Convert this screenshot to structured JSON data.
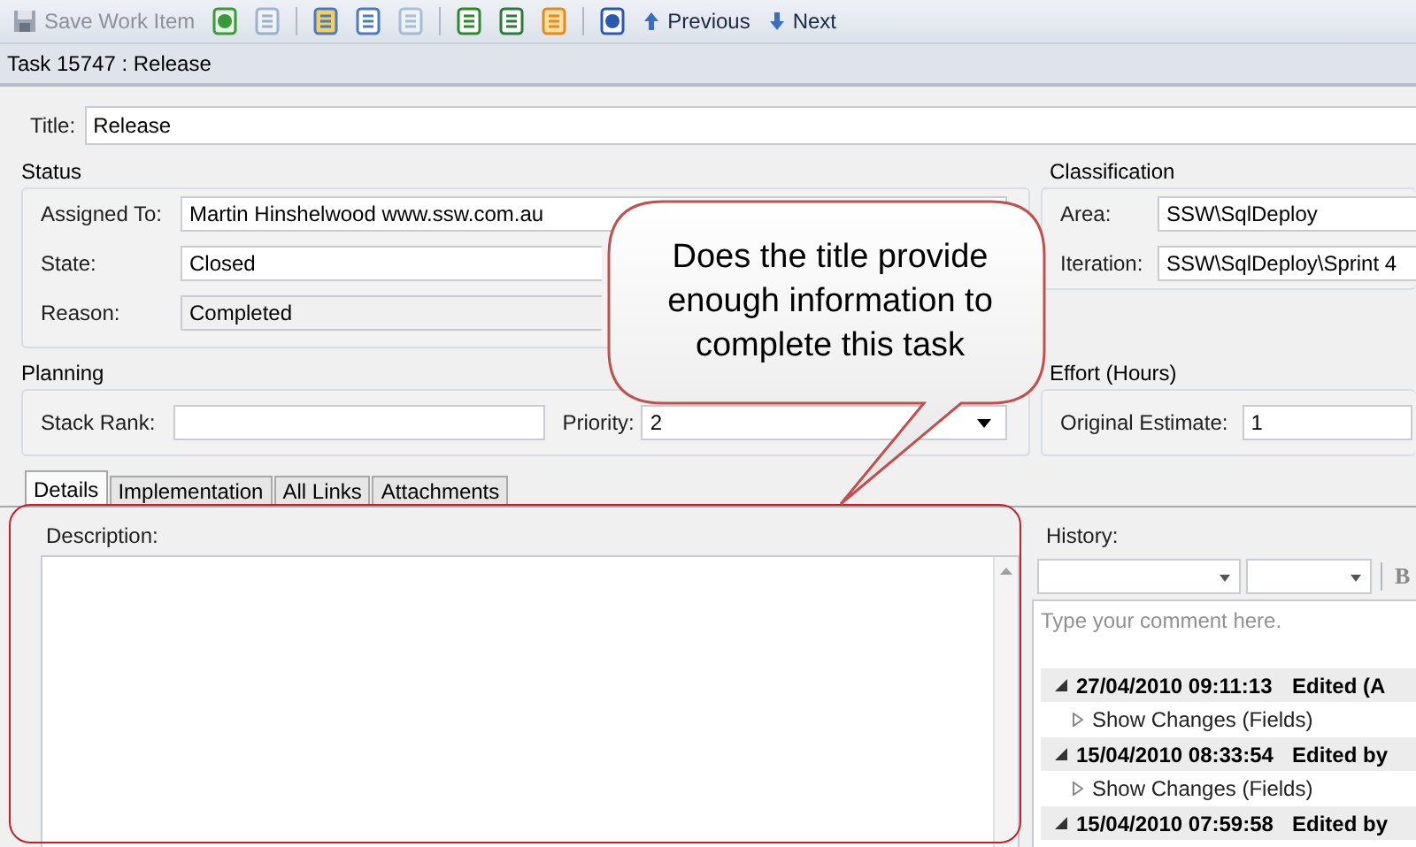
{
  "toolbar": {
    "save": {
      "label": "Save Work Item",
      "disabled": true
    },
    "icon_buttons": [
      {
        "disabled": false
      },
      {
        "disabled": true
      },
      {
        "disabled": false
      },
      {
        "disabled": false
      },
      {
        "disabled": true
      },
      {
        "disabled": false
      },
      {
        "disabled": false
      },
      {
        "disabled": false
      },
      {
        "disabled": false
      }
    ],
    "previous": "Previous",
    "next": "Next"
  },
  "document_title": "Task 15747 : Release",
  "title": {
    "label": "Title:",
    "value": "Release"
  },
  "status": {
    "heading": "Status",
    "fields": [
      {
        "label": "Assigned To:",
        "value": "Martin Hinshelwood www.ssw.com.au",
        "kind": "dropdown",
        "readonly": false
      },
      {
        "label": "State:",
        "value": "Closed",
        "kind": "text",
        "readonly": false
      },
      {
        "label": "Reason:",
        "value": "Completed",
        "kind": "text",
        "readonly": true
      }
    ]
  },
  "classification": {
    "heading": "Classification",
    "fields": [
      {
        "label": "Area:",
        "value": "SSW\\SqlDeploy"
      },
      {
        "label": "Iteration:",
        "value": "SSW\\SqlDeploy\\Sprint 4"
      }
    ]
  },
  "planning": {
    "heading": "Planning",
    "stack_rank": {
      "label": "Stack Rank:"
    },
    "priority": {
      "label": "Priority:",
      "value": "2"
    }
  },
  "effort": {
    "heading": "Effort (Hours)",
    "original_estimate": {
      "label": "Original Estimate:",
      "value": "1"
    }
  },
  "tabs": [
    {
      "label": "Details",
      "selected": true
    },
    {
      "label": "Implementation",
      "selected": false
    },
    {
      "label": "All Links",
      "selected": false
    },
    {
      "label": "Attachments",
      "selected": false
    }
  ],
  "description": {
    "label": "Description:"
  },
  "history": {
    "label": "History:",
    "bold_button": "B",
    "comment": {
      "placeholder": "Type your comment here."
    },
    "entries": [
      {
        "date": "27/04/2010 09:11:13",
        "action": "Edited (A",
        "expanded": true,
        "changes": "Show Changes (Fields)"
      },
      {
        "date": "15/04/2010 08:33:54",
        "action": "Edited by",
        "expanded": true,
        "changes": "Show Changes (Fields)"
      },
      {
        "date": "15/04/2010 07:59:58",
        "action": "Edited by",
        "expanded": true
      }
    ]
  },
  "callout": {
    "text": "Does the title provide enough information to complete this task"
  }
}
